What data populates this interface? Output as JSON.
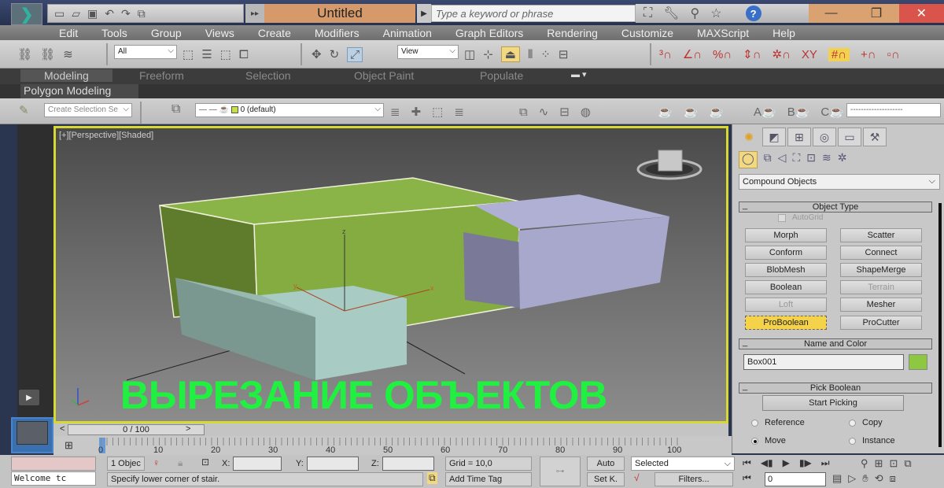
{
  "titlebar": {
    "logo_icon": "3dsmax-logo-icon",
    "title": "Untitled",
    "search_placeholder": "Type a keyword or phrase",
    "quick_access": [
      "new-icon",
      "open-icon",
      "save-icon",
      "undo-icon",
      "redo-icon",
      "project-icon"
    ],
    "tools": [
      "binoculars-icon",
      "wrench-icon",
      "satellite-icon",
      "star-icon",
      "help-icon"
    ],
    "window_controls": {
      "minimize": "—",
      "maximize": "❐",
      "close": "✕"
    }
  },
  "menu": [
    "Edit",
    "Tools",
    "Group",
    "Views",
    "Create",
    "Modifiers",
    "Animation",
    "Graph Editors",
    "Rendering",
    "Customize",
    "MAXScript",
    "Help"
  ],
  "toolbar": {
    "selection_filter": "All",
    "reference_coord": "View",
    "named_selection_placeholder": "Create Selection Se",
    "layer": "0 (default)",
    "render_field": "--------------------"
  },
  "ribbon": {
    "tabs": [
      "Modeling",
      "Freeform",
      "Selection",
      "Object Paint",
      "Populate"
    ],
    "active_tab": "Modeling",
    "panel": "Polygon Modeling"
  },
  "viewport": {
    "label": "[+][Perspective][Shaded]",
    "overlay_caption": "ВЫРЕЗАНИЕ ОБЪЕКТОВ",
    "colors": {
      "border": "#d8d832",
      "green_box": "#86ad42",
      "purple_box": "#a8a8cc",
      "teal_box": "#a8ccc4",
      "caption": "#20f040"
    }
  },
  "command_panel": {
    "category": "Compound Objects",
    "object_type": {
      "header": "Object Type",
      "autogrid": "AutoGrid",
      "buttons": [
        {
          "label": "Morph",
          "state": "normal"
        },
        {
          "label": "Scatter",
          "state": "normal"
        },
        {
          "label": "Conform",
          "state": "normal"
        },
        {
          "label": "Connect",
          "state": "normal"
        },
        {
          "label": "BlobMesh",
          "state": "normal"
        },
        {
          "label": "ShapeMerge",
          "state": "normal"
        },
        {
          "label": "Boolean",
          "state": "normal"
        },
        {
          "label": "Terrain",
          "state": "disabled"
        },
        {
          "label": "Loft",
          "state": "disabled"
        },
        {
          "label": "Mesher",
          "state": "normal"
        },
        {
          "label": "ProBoolean",
          "state": "active"
        },
        {
          "label": "ProCutter",
          "state": "normal"
        }
      ]
    },
    "name_color": {
      "header": "Name and Color",
      "name": "Box001",
      "color": "#8dc840"
    },
    "pick_boolean": {
      "header": "Pick Boolean",
      "start_picking": "Start Picking",
      "options": [
        {
          "label": "Reference",
          "checked": false
        },
        {
          "label": "Copy",
          "checked": false
        },
        {
          "label": "Move",
          "checked": true
        },
        {
          "label": "Instance",
          "checked": false
        }
      ]
    }
  },
  "timeline": {
    "slider": "0 / 100",
    "prev": "<",
    "next": ">",
    "ticks": [
      "0",
      "10",
      "20",
      "30",
      "40",
      "50",
      "60",
      "70",
      "80",
      "90",
      "100"
    ]
  },
  "status": {
    "maxscript": "Welcome tc",
    "selection_count": "1 Objec",
    "x_label": "X:",
    "y_label": "Y:",
    "z_label": "Z:",
    "grid": "Grid = 10,0",
    "prompt": "Specify lower corner of stair.",
    "add_time_tag": "Add Time Tag",
    "auto": "Auto",
    "set_key": "Set K.",
    "key_filter": "Selected",
    "filters": "Filters...",
    "frame": "0"
  }
}
